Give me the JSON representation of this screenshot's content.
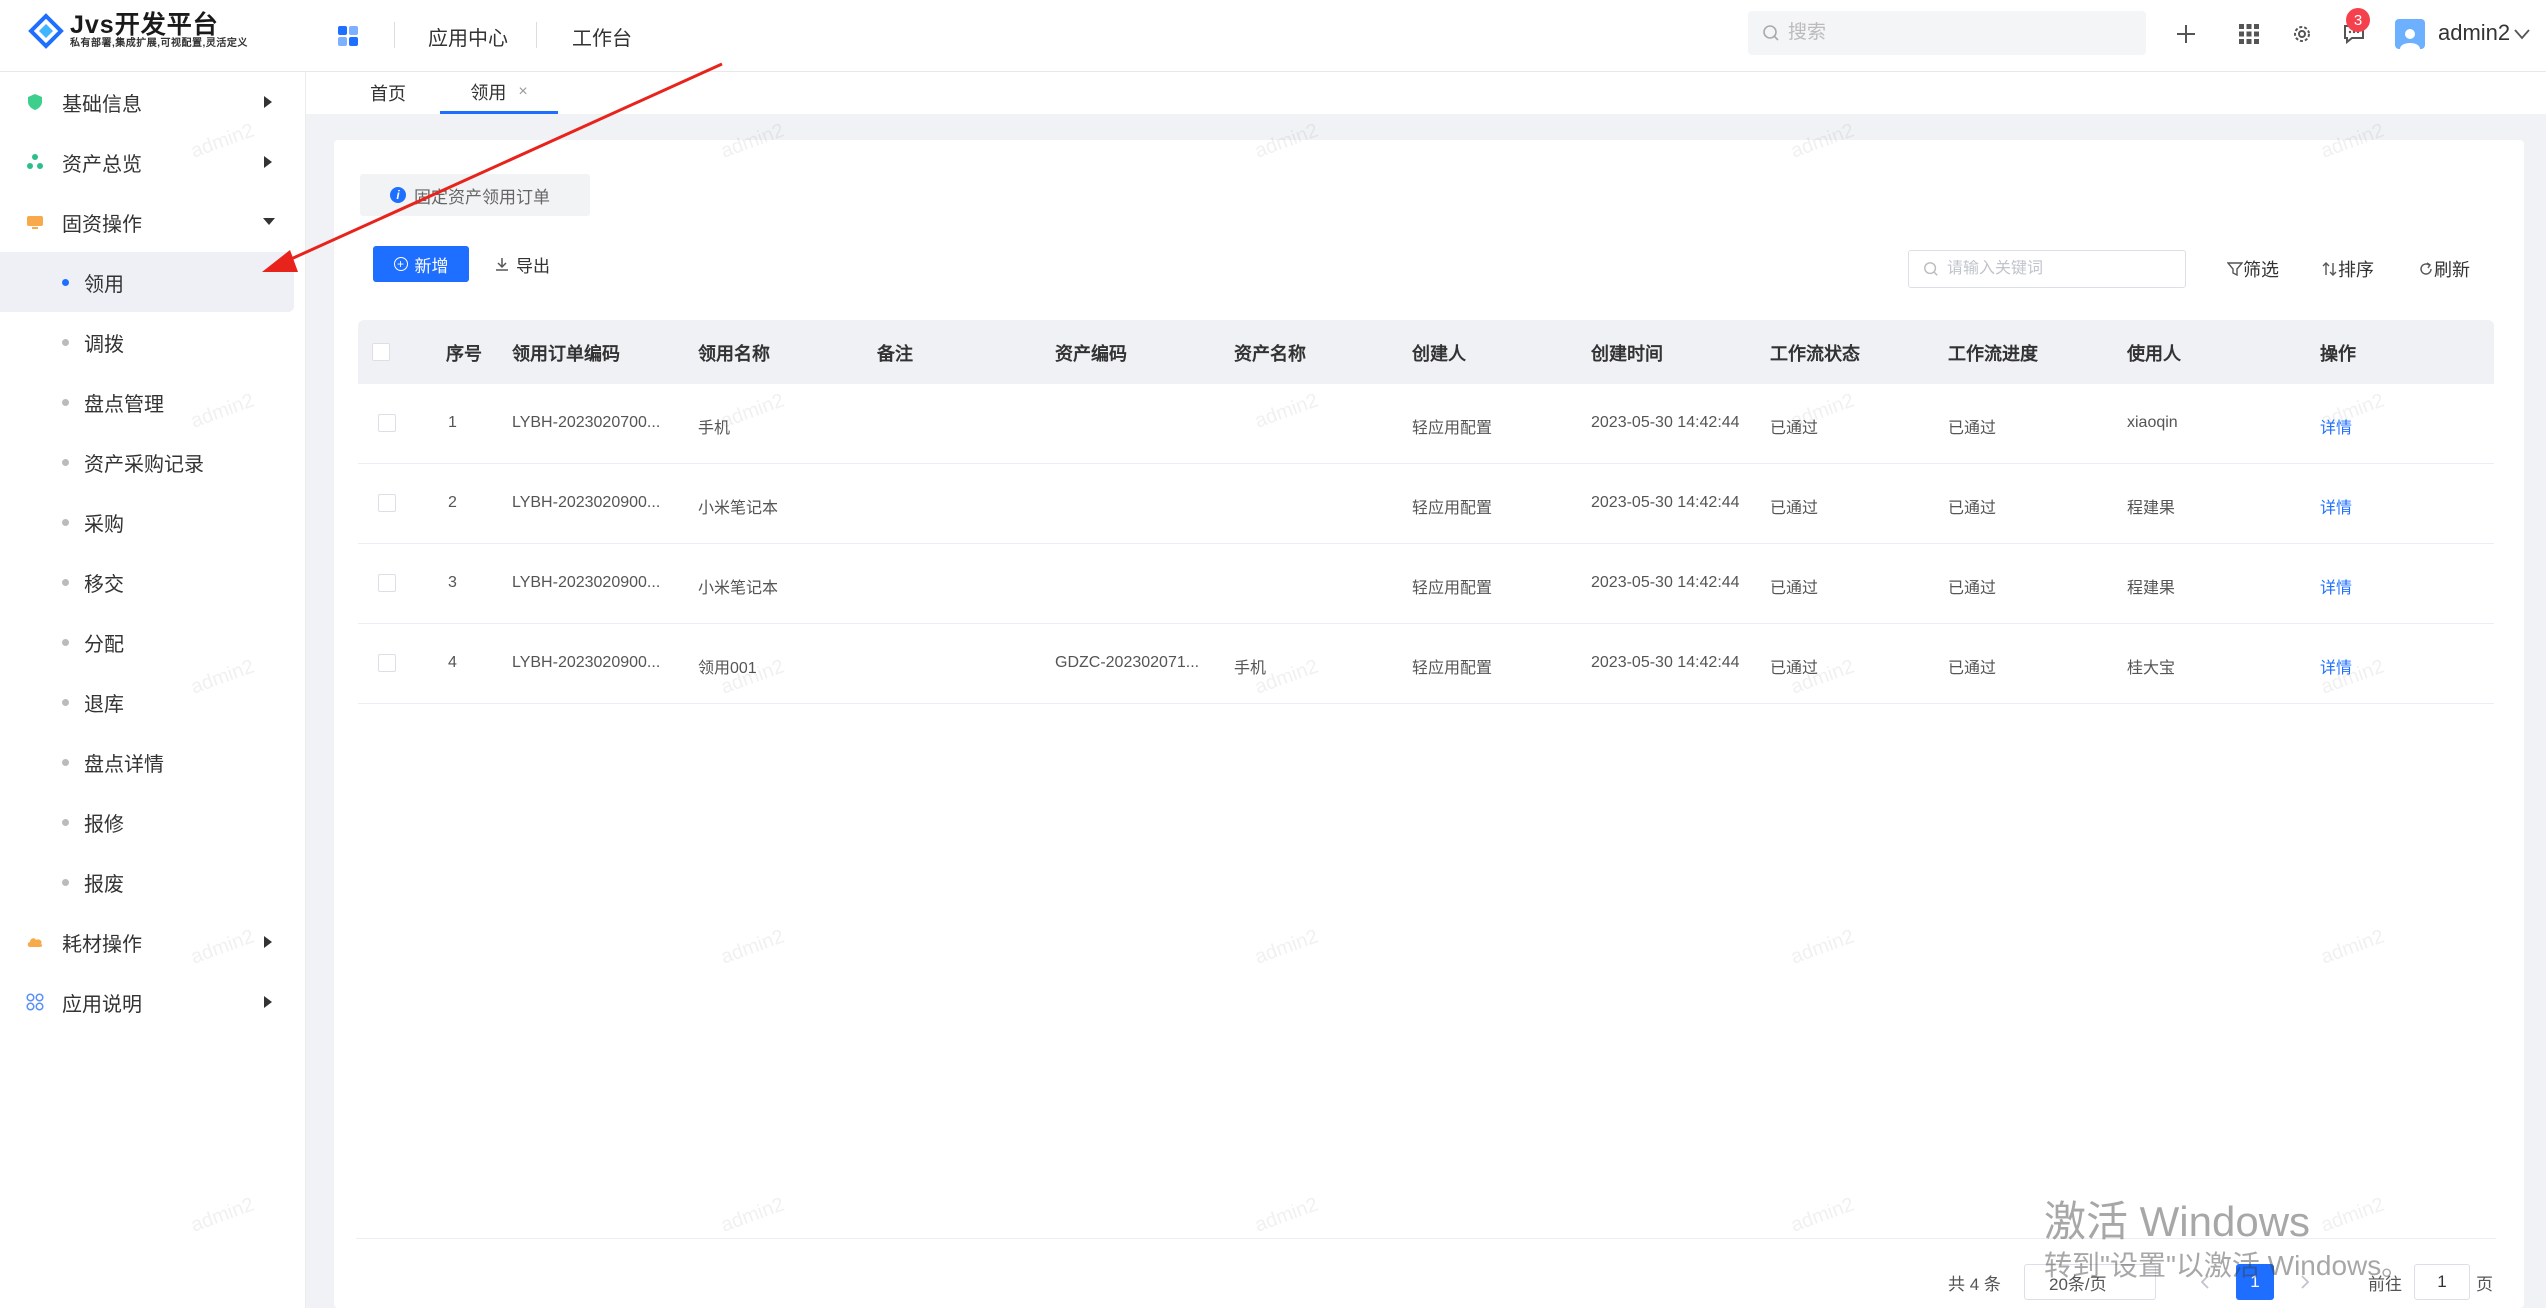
{
  "app": {
    "title": "Jvs开发平台",
    "subtitle": "私有部署,集成扩展,可视配置,灵活定义"
  },
  "header": {
    "nav": [
      "应用中心",
      "工作台"
    ],
    "search_placeholder": "搜索",
    "notification_count": "3",
    "username": "admin2"
  },
  "sidebar": {
    "groups": [
      {
        "label": "基础信息",
        "icon": "shield-icon"
      },
      {
        "label": "资产总览",
        "icon": "nodes-icon"
      },
      {
        "label": "固资操作",
        "icon": "monitor-icon"
      },
      {
        "label": "耗材操作",
        "icon": "cloud-icon"
      },
      {
        "label": "应用说明",
        "icon": "grid-icon"
      }
    ],
    "items": [
      "领用",
      "调拨",
      "盘点管理",
      "资产采购记录",
      "采购",
      "移交",
      "分配",
      "退库",
      "盘点详情",
      "报修",
      "报废"
    ]
  },
  "tabs": [
    {
      "label": "首页"
    },
    {
      "label": "领用",
      "close": "×"
    }
  ],
  "toolbar": {
    "tip": "固定资产领用订单",
    "add_label": "新增",
    "export_label": "导出",
    "keyword_placeholder": "请输入关键词",
    "filter_label": "筛选",
    "sort_label": "排序",
    "refresh_label": "刷新"
  },
  "table": {
    "columns": [
      "序号",
      "领用订单编码",
      "领用名称",
      "备注",
      "资产编码",
      "资产名称",
      "创建人",
      "创建时间",
      "工作流状态",
      "工作流进度",
      "使用人",
      "操作"
    ],
    "rows": [
      {
        "no": "1",
        "code": "LYBH-2023020700...",
        "name": "手机",
        "remark": "",
        "asset_code": "",
        "asset_name": "",
        "creator": "轻应用配置",
        "created": "2023-05-30 14:42:44",
        "wf_status": "已通过",
        "wf_progress": "已通过",
        "user": "xiaoqin",
        "action": "详情"
      },
      {
        "no": "2",
        "code": "LYBH-2023020900...",
        "name": "小米笔记本",
        "remark": "",
        "asset_code": "",
        "asset_name": "",
        "creator": "轻应用配置",
        "created": "2023-05-30 14:42:44",
        "wf_status": "已通过",
        "wf_progress": "已通过",
        "user": "程建果",
        "action": "详情"
      },
      {
        "no": "3",
        "code": "LYBH-2023020900...",
        "name": "小米笔记本",
        "remark": "",
        "asset_code": "",
        "asset_name": "",
        "creator": "轻应用配置",
        "created": "2023-05-30 14:42:44",
        "wf_status": "已通过",
        "wf_progress": "已通过",
        "user": "程建果",
        "action": "详情"
      },
      {
        "no": "4",
        "code": "LYBH-2023020900...",
        "name": "领用001",
        "remark": "",
        "asset_code": "GDZC-202302071...",
        "asset_name": "手机",
        "creator": "轻应用配置",
        "created": "2023-05-30 14:42:44",
        "wf_status": "已通过",
        "wf_progress": "已通过",
        "user": "桂大宝",
        "action": "详情"
      }
    ]
  },
  "pagination": {
    "total": "共 4 条",
    "page_size": "20条/页",
    "current_page": "1",
    "goto_label": "前往",
    "goto_value": "1",
    "page_suffix": "页"
  },
  "watermark": "admin2",
  "activation": {
    "line1": "激活 Windows",
    "line2": "转到\"设置\"以激活 Windows。"
  },
  "colors": {
    "primary": "#1e6fff",
    "annotation_arrow": "#e8231b",
    "badge": "#f5414d"
  }
}
